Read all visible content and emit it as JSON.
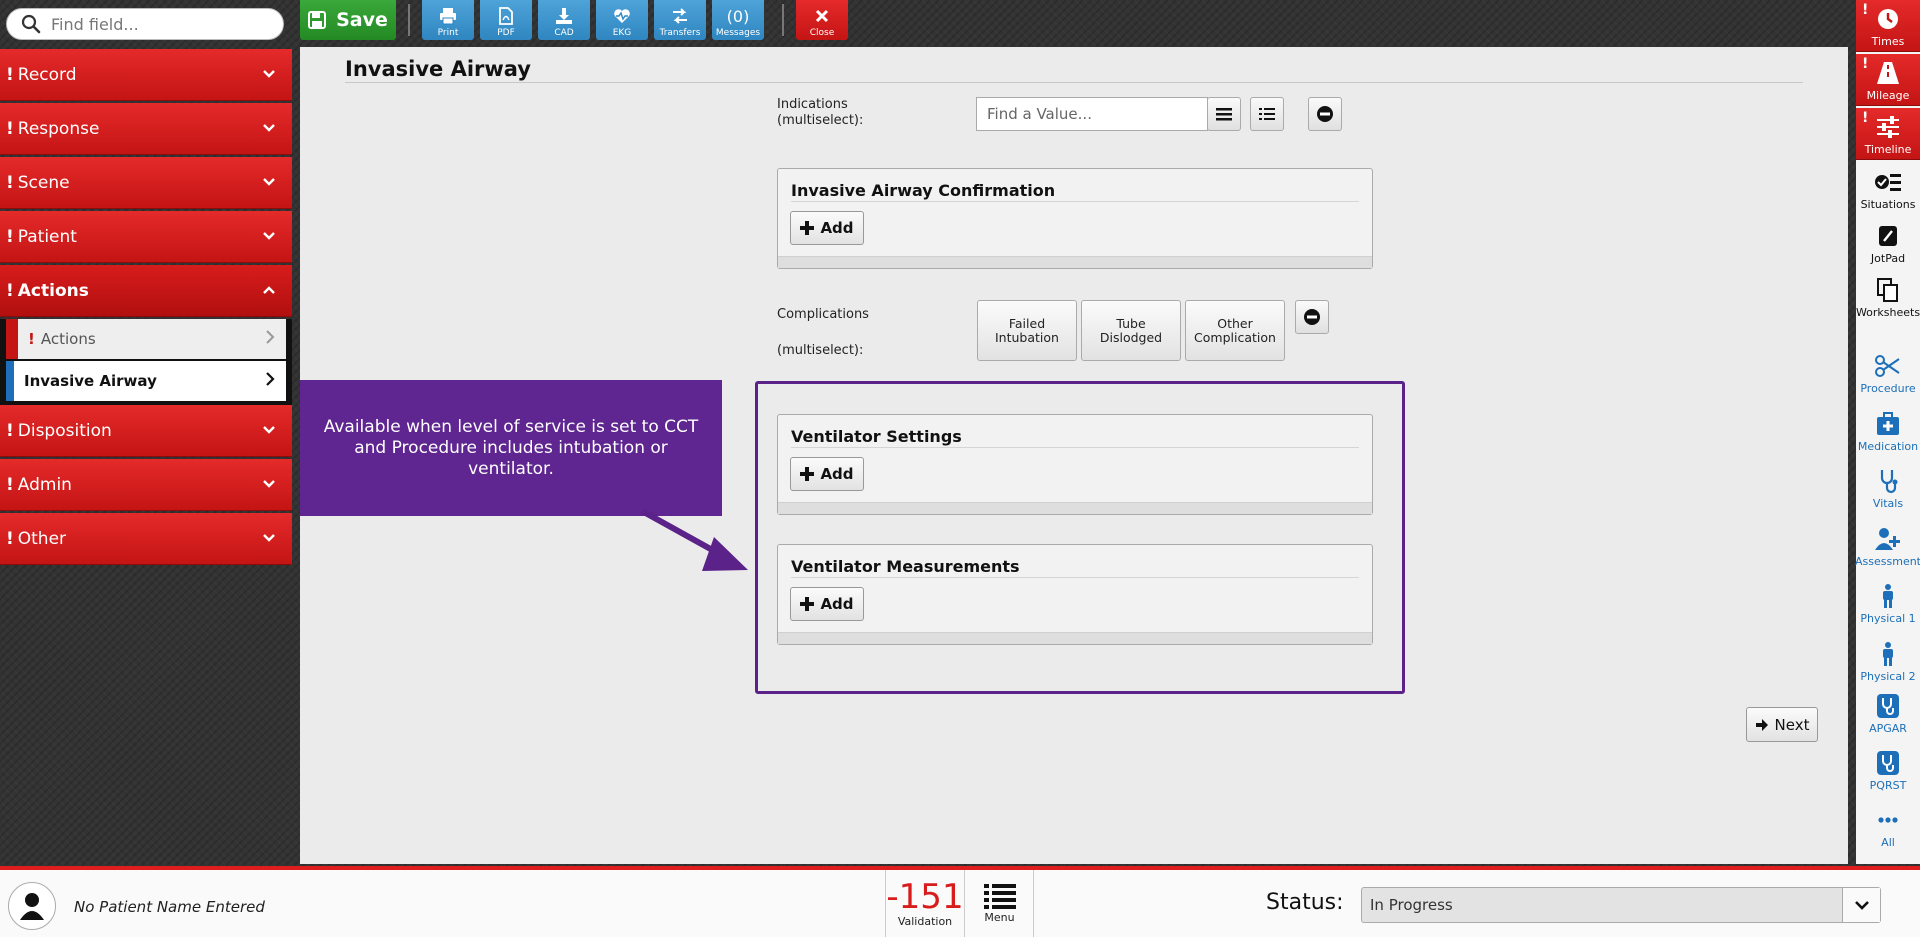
{
  "search": {
    "placeholder": "Find field..."
  },
  "toolbar": {
    "save": "Save",
    "buttons": [
      {
        "label": "Print",
        "icon": "print-icon"
      },
      {
        "label": "PDF",
        "icon": "pdf-icon"
      },
      {
        "label": "CAD",
        "icon": "download-icon"
      },
      {
        "label": "EKG",
        "icon": "ekg-icon"
      },
      {
        "label": "Transfers",
        "icon": "transfer-icon"
      },
      {
        "label": "Messages",
        "count": "(0)"
      }
    ],
    "close": "Close"
  },
  "sidebar": {
    "items": [
      {
        "label": "Record"
      },
      {
        "label": "Response"
      },
      {
        "label": "Scene"
      },
      {
        "label": "Patient"
      },
      {
        "label": "Actions"
      },
      {
        "label": "Disposition"
      },
      {
        "label": "Admin"
      },
      {
        "label": "Other"
      }
    ],
    "sub_items": [
      {
        "label": "Actions"
      },
      {
        "label": "Invasive Airway"
      }
    ]
  },
  "main": {
    "title": "Invasive Airway",
    "indications_label": "Indications\n(multiselect):",
    "indications_placeholder": "Find a Value...",
    "confirmation_title": "Invasive Airway Confirmation",
    "complications_label": "Complications",
    "complications_sub": "(multiselect):",
    "complication_options": [
      "Failed Intubation",
      "Tube Dislodged",
      "Other Complication"
    ],
    "vent_settings_title": "Ventilator Settings",
    "vent_measurements_title": "Ventilator Measurements",
    "add_label": "Add",
    "next_label": "Next",
    "callout_text": "Available when level of service is set to CCT and Procedure includes intubation or ventilator."
  },
  "rail": {
    "items": [
      {
        "label": "Times",
        "icon": "clock-icon"
      },
      {
        "label": "Mileage",
        "icon": "road-icon"
      },
      {
        "label": "Timeline",
        "icon": "sliders-icon"
      },
      {
        "label": "Situations",
        "icon": "checklist-icon"
      },
      {
        "label": "JotPad",
        "icon": "pencil-icon"
      },
      {
        "label": "Worksheets",
        "icon": "copy-icon"
      },
      {
        "label": "Procedure",
        "icon": "scissors-icon"
      },
      {
        "label": "Medication",
        "icon": "medkit-icon"
      },
      {
        "label": "Vitals",
        "icon": "stethoscope-icon"
      },
      {
        "label": "Assessment",
        "icon": "user-plus-icon"
      },
      {
        "label": "Physical 1",
        "icon": "person-icon"
      },
      {
        "label": "Physical 2",
        "icon": "person-icon"
      },
      {
        "label": "APGAR",
        "icon": "stethoscope-box-icon"
      },
      {
        "label": "PQRST",
        "icon": "stethoscope-box-icon"
      },
      {
        "label": "All",
        "icon": "ellipsis-icon"
      }
    ]
  },
  "bottom": {
    "patient_name": "No Patient Name Entered",
    "validation_count": "-151",
    "validation_label": "Validation",
    "menu_label": "Menu",
    "status_label": "Status:",
    "status_value": "In Progress"
  },
  "colors": {
    "nav_red": "#d81c1c",
    "save_green": "#2e9a2e",
    "toolbar_blue": "#3a93cc",
    "callout_purple": "#5f2590",
    "accent_blue": "#1c6fb8"
  }
}
